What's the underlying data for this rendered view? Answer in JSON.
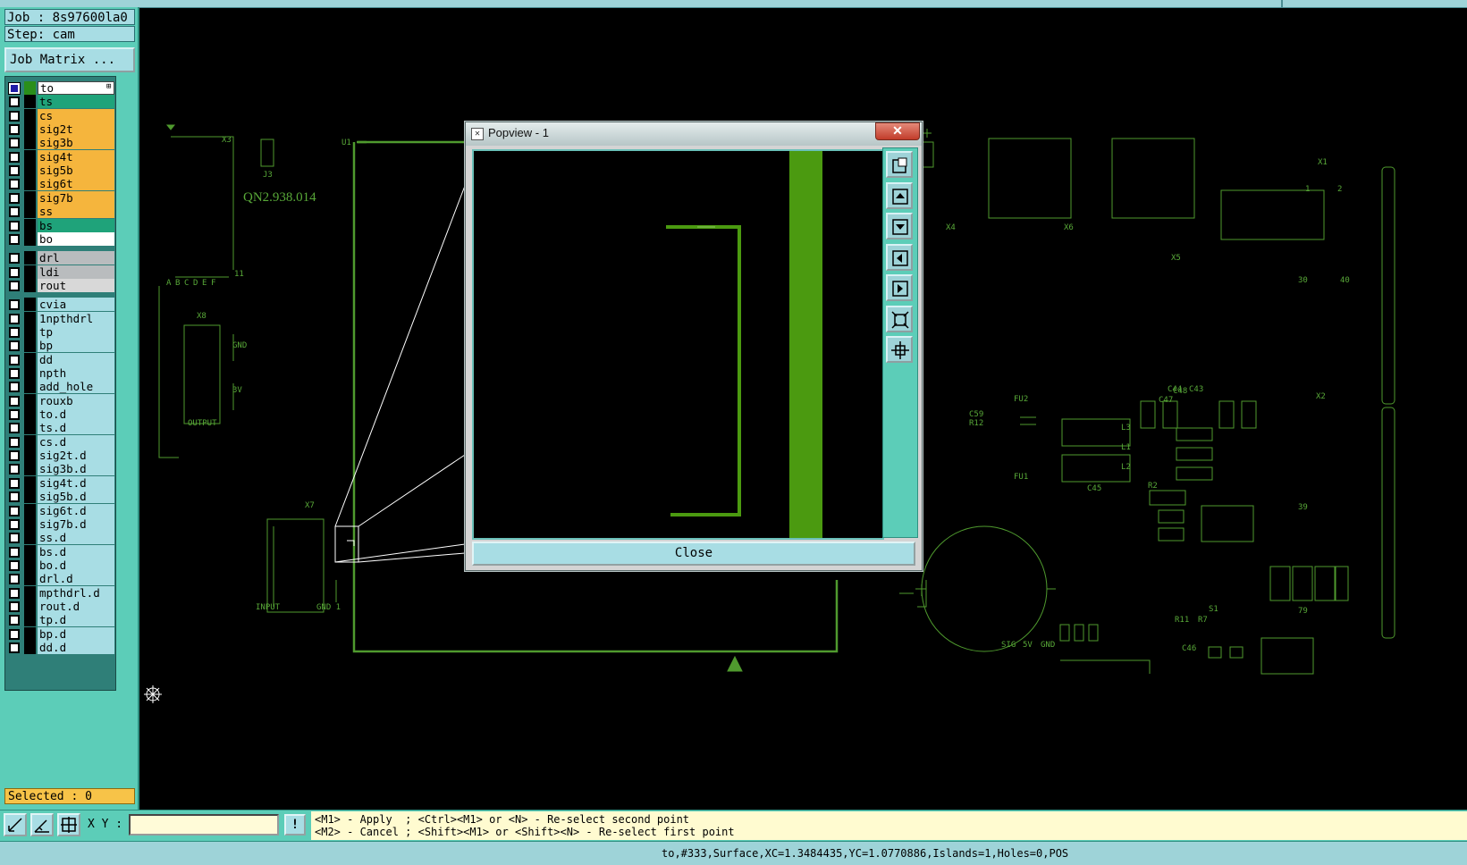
{
  "job": {
    "label": "Job : 8s97600la0",
    "step": "Step: cam",
    "matrix_button": "Job Matrix ..."
  },
  "layers": {
    "group1": [
      {
        "name": "to",
        "color": "#ffffff",
        "checked": true,
        "active": true,
        "swatch": "green"
      },
      {
        "name": "ts",
        "color": "#1fa37a"
      },
      {
        "name": "cs",
        "color": "#f5b53d"
      },
      {
        "name": "sig2t",
        "color": "#f5b53d"
      },
      {
        "name": "sig3b",
        "color": "#f5b53d"
      },
      {
        "name": "sig4t",
        "color": "#f5b53d"
      },
      {
        "name": "sig5b",
        "color": "#f5b53d"
      },
      {
        "name": "sig6t",
        "color": "#f5b53d"
      },
      {
        "name": "sig7b",
        "color": "#f5b53d"
      },
      {
        "name": "ss",
        "color": "#f5b53d"
      },
      {
        "name": "bs",
        "color": "#1fa37a"
      },
      {
        "name": "bo",
        "color": "#ffffff"
      }
    ],
    "group2": [
      {
        "name": "drl",
        "color": "#b9bcbe"
      },
      {
        "name": "ldi",
        "color": "#b9bcbe"
      },
      {
        "name": "rout",
        "color": "#d8d8d8"
      }
    ],
    "group3": [
      {
        "name": "cvia"
      },
      {
        "name": "1npthdrl"
      },
      {
        "name": "tp"
      },
      {
        "name": "bp"
      },
      {
        "name": "dd"
      },
      {
        "name": "npth"
      },
      {
        "name": "add_hole"
      },
      {
        "name": "rouxb"
      },
      {
        "name": "to.d"
      },
      {
        "name": "ts.d"
      },
      {
        "name": "cs.d"
      },
      {
        "name": "sig2t.d"
      },
      {
        "name": "sig3b.d"
      },
      {
        "name": "sig4t.d"
      },
      {
        "name": "sig5b.d"
      },
      {
        "name": "sig6t.d"
      },
      {
        "name": "sig7b.d"
      },
      {
        "name": "ss.d"
      },
      {
        "name": "bs.d"
      },
      {
        "name": "bo.d"
      },
      {
        "name": "drl.d"
      },
      {
        "name": "mpthdrl.d"
      },
      {
        "name": "rout.d"
      },
      {
        "name": "tp.d"
      },
      {
        "name": "bp.d"
      },
      {
        "name": "dd.d"
      }
    ],
    "group3_color": "#a8dde4",
    "active_mark": "⊞"
  },
  "selected": "Selected : 0",
  "canvas": {
    "part_number": "QN2.938.014",
    "labels": [
      "U1",
      "X3",
      "J3",
      "X8",
      "GND",
      "3V",
      "OUTPUT",
      "X7",
      "INPUT",
      "GND 1",
      "FU2",
      "FU1",
      "X4",
      "X6",
      "X5",
      "X1",
      "X2",
      "R2",
      "S1",
      "C46",
      "C47",
      "C48",
      "L3",
      "L1",
      "L2",
      "C45",
      "C44",
      "C43",
      "C59",
      "R12",
      "R11",
      "R7",
      "SIG",
      "5V",
      "GND",
      "+",
      "1",
      "2",
      "30",
      "40",
      "39",
      "79",
      "A",
      "B",
      "C",
      "D",
      "E",
      "F",
      "11"
    ],
    "accent_color": "#58a838"
  },
  "popview": {
    "title": "Popview - 1",
    "close_x": "✕",
    "close_label": "Close",
    "tools": [
      "zoom-fit-icon",
      "pan-up-icon",
      "pan-down-icon",
      "pan-left-icon",
      "pan-right-icon",
      "zoom-extents-icon",
      "zoom-home-icon"
    ]
  },
  "cmd": {
    "xy_label": "X Y :",
    "xy_value": "",
    "excl": "!",
    "hint1": "<M1> - Apply  ; <Ctrl><M1> or <N> - Re-select second point",
    "hint2": "<M2> - Cancel ; <Shift><M1> or <Shift><N> - Re-select first point"
  },
  "status": "to,#333,Surface,XC=1.3484435,YC=1.0770886,Islands=1,Holes=0,POS"
}
